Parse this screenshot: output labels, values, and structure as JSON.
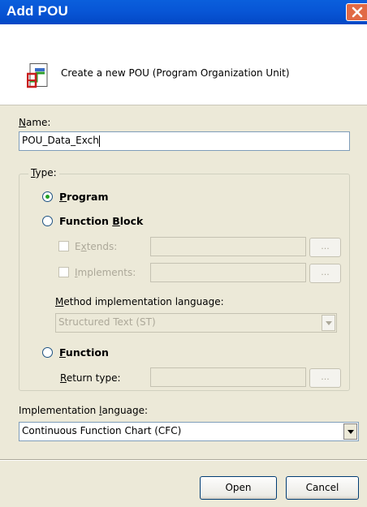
{
  "window": {
    "title": "Add POU"
  },
  "header": {
    "description": "Create a new POU (Program Organization Unit)"
  },
  "name": {
    "label": "Name:",
    "value": "POU_Data_Exch"
  },
  "type_group": {
    "label": "Type:",
    "program": {
      "label": "Program",
      "checked": true
    },
    "function_block": {
      "label": "Function Block",
      "extends_label": "Extends:",
      "implements_label": "Implements:",
      "ellipsis": "...",
      "method_language_label": "Method implementation language:",
      "method_language_value": "Structured Text (ST)"
    },
    "function": {
      "label": "Function",
      "return_type_label": "Return type:",
      "ellipsis": "..."
    }
  },
  "implementation_language": {
    "label": "Implementation language:",
    "value": "Continuous Function Chart (CFC)"
  },
  "buttons": {
    "open": "Open",
    "cancel": "Cancel"
  },
  "icons": {
    "close": "close-icon",
    "pou": "pou-icon",
    "dropdown": "chevron-down-icon"
  },
  "colors": {
    "title_bar": "#0a5fdc",
    "close_button": "#e16a45",
    "dialog_background": "#ece9d8"
  }
}
